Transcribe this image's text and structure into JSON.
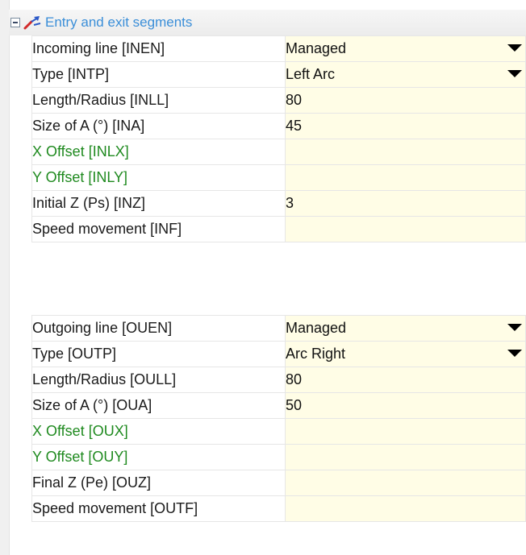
{
  "section": {
    "title": "Entry and exit segments",
    "icon": "pen-arrow-icon",
    "expanded": true
  },
  "incoming": [
    {
      "label": "Incoming line [INEN]",
      "value": "Managed",
      "dropdown": true,
      "green": false
    },
    {
      "label": "Type [INTP]",
      "value": "Left Arc",
      "dropdown": true,
      "green": false
    },
    {
      "label": "Length/Radius [INLL]",
      "value": "80",
      "dropdown": false,
      "green": false
    },
    {
      "label": "Size of A (°) [INA]",
      "value": "45",
      "dropdown": false,
      "green": false
    },
    {
      "label": "X Offset [INLX]",
      "value": "",
      "dropdown": false,
      "green": true
    },
    {
      "label": "Y Offset [INLY]",
      "value": "",
      "dropdown": false,
      "green": true
    },
    {
      "label": "Initial Z (Ps) [INZ]",
      "value": "3",
      "dropdown": false,
      "green": false
    },
    {
      "label": "Speed movement [INF]",
      "value": "",
      "dropdown": false,
      "green": false
    }
  ],
  "outgoing": [
    {
      "label": "Outgoing line [OUEN]",
      "value": "Managed",
      "dropdown": true,
      "green": false
    },
    {
      "label": "Type [OUTP]",
      "value": "Arc Right",
      "dropdown": true,
      "green": false
    },
    {
      "label": "Length/Radius [OULL]",
      "value": "80",
      "dropdown": false,
      "green": false
    },
    {
      "label": "Size of A (°) [OUA]",
      "value": "50",
      "dropdown": false,
      "green": false
    },
    {
      "label": "X Offset [OUX]",
      "value": "",
      "dropdown": false,
      "green": true
    },
    {
      "label": "Y Offset [OUY]",
      "value": "",
      "dropdown": false,
      "green": true
    },
    {
      "label": "Final Z (Pe) [OUZ]",
      "value": "",
      "dropdown": false,
      "green": false
    },
    {
      "label": "Speed movement [OUTF]",
      "value": "",
      "dropdown": false,
      "green": false
    }
  ],
  "colors": {
    "header_text": "#3a8ed8",
    "value_bg": "#fffde6",
    "green_label": "#1f8a1f"
  }
}
